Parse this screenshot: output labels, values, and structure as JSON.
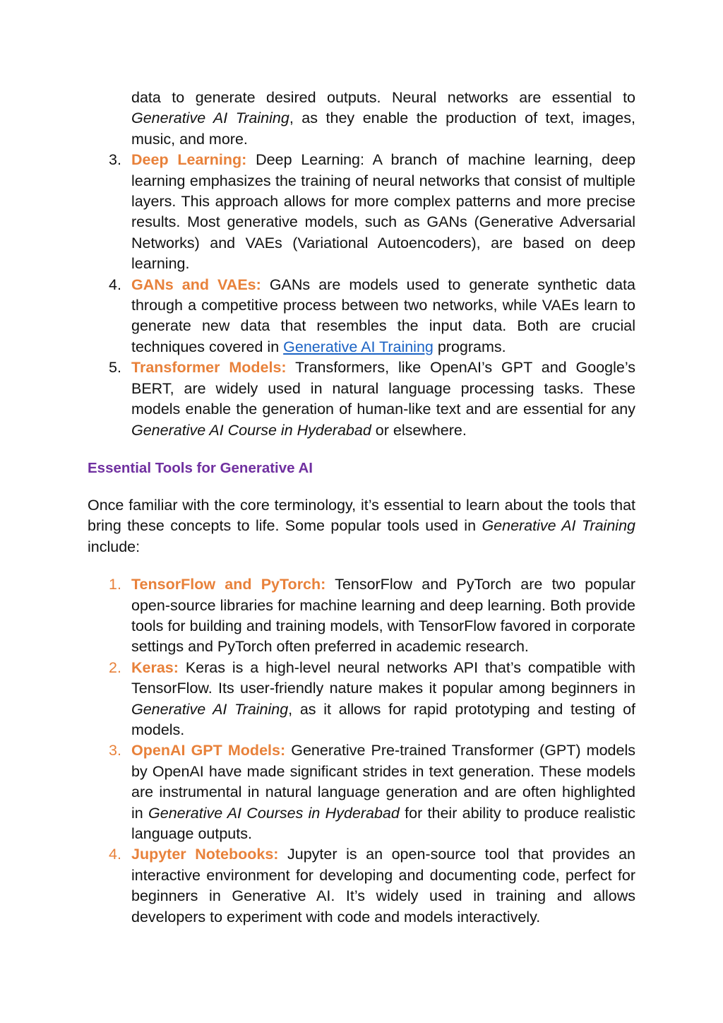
{
  "intro_continuation": {
    "text_1": "data to generate desired outputs. Neural networks are essential to ",
    "italic_1": "Generative AI Training",
    "text_2": ", as they enable the production of text, images, music, and more."
  },
  "terminology_list": [
    {
      "number": "3.",
      "term": "Deep Learning:",
      "body": " Deep Learning: A branch of machine learning, deep learning emphasizes the training of neural networks that consist of multiple layers. This approach allows for more complex patterns and more precise results. Most generative models, such as GANs (Generative Adversarial Networks) and VAEs (Variational Autoencoders), are based on deep learning."
    },
    {
      "number": "4.",
      "term": "GANs and VAEs:",
      "body": " GANs are models used to generate synthetic data through a competitive process between two networks, while VAEs learn to generate new data that resembles the input data. Both are crucial techniques covered in ",
      "link": "Generative AI Training",
      "body_after": " programs."
    },
    {
      "number": "5.",
      "term": "Transformer Models:",
      "body": " Transformers, like OpenAI’s GPT and Google’s BERT, are widely used in natural language processing tasks. These models enable the generation of human-like text and are essential for any ",
      "italic": "Generative AI Course in Hyderabad",
      "body_after": " or elsewhere."
    }
  ],
  "section": {
    "heading": "Essential Tools for Generative AI",
    "intro_text": "Once familiar with the core terminology, it’s essential to learn about the tools that bring these concepts to life. Some popular tools used in ",
    "intro_italic": "Generative AI Training",
    "intro_after": " include:"
  },
  "tools_list": [
    {
      "number": "1.",
      "term": "TensorFlow and PyTorch:",
      "body": " TensorFlow and PyTorch are two popular open-source libraries for machine learning and deep learning. Both provide tools for building and training models, with TensorFlow favored in corporate settings and PyTorch often preferred in academic research."
    },
    {
      "number": "2.",
      "term": "Keras:",
      "body": " Keras is a high-level neural networks API that’s compatible with TensorFlow. Its user-friendly nature makes it popular among beginners in ",
      "italic": "Generative AI Training",
      "body_after": ", as it allows for rapid prototyping and testing of models."
    },
    {
      "number": "3.",
      "term": "OpenAI GPT Models:",
      "body": " Generative Pre-trained Transformer (GPT) models by OpenAI have made significant strides in text generation. These models are instrumental in natural language generation and are often highlighted in ",
      "italic": "Generative AI Courses in Hyderabad",
      "body_after": " for their ability to produce realistic language outputs."
    },
    {
      "number": "4.",
      "term": "Jupyter Notebooks:",
      "body": " Jupyter is an open-source tool that provides an interactive environment for developing and documenting code, perfect for beginners in Generative AI. It’s widely used in training and allows developers to experiment with code and models interactively."
    }
  ],
  "colors": {
    "term_orange": "#e8813a",
    "heading_purple": "#7030a0",
    "link_blue": "#1a62c4",
    "body_text": "#111111"
  }
}
